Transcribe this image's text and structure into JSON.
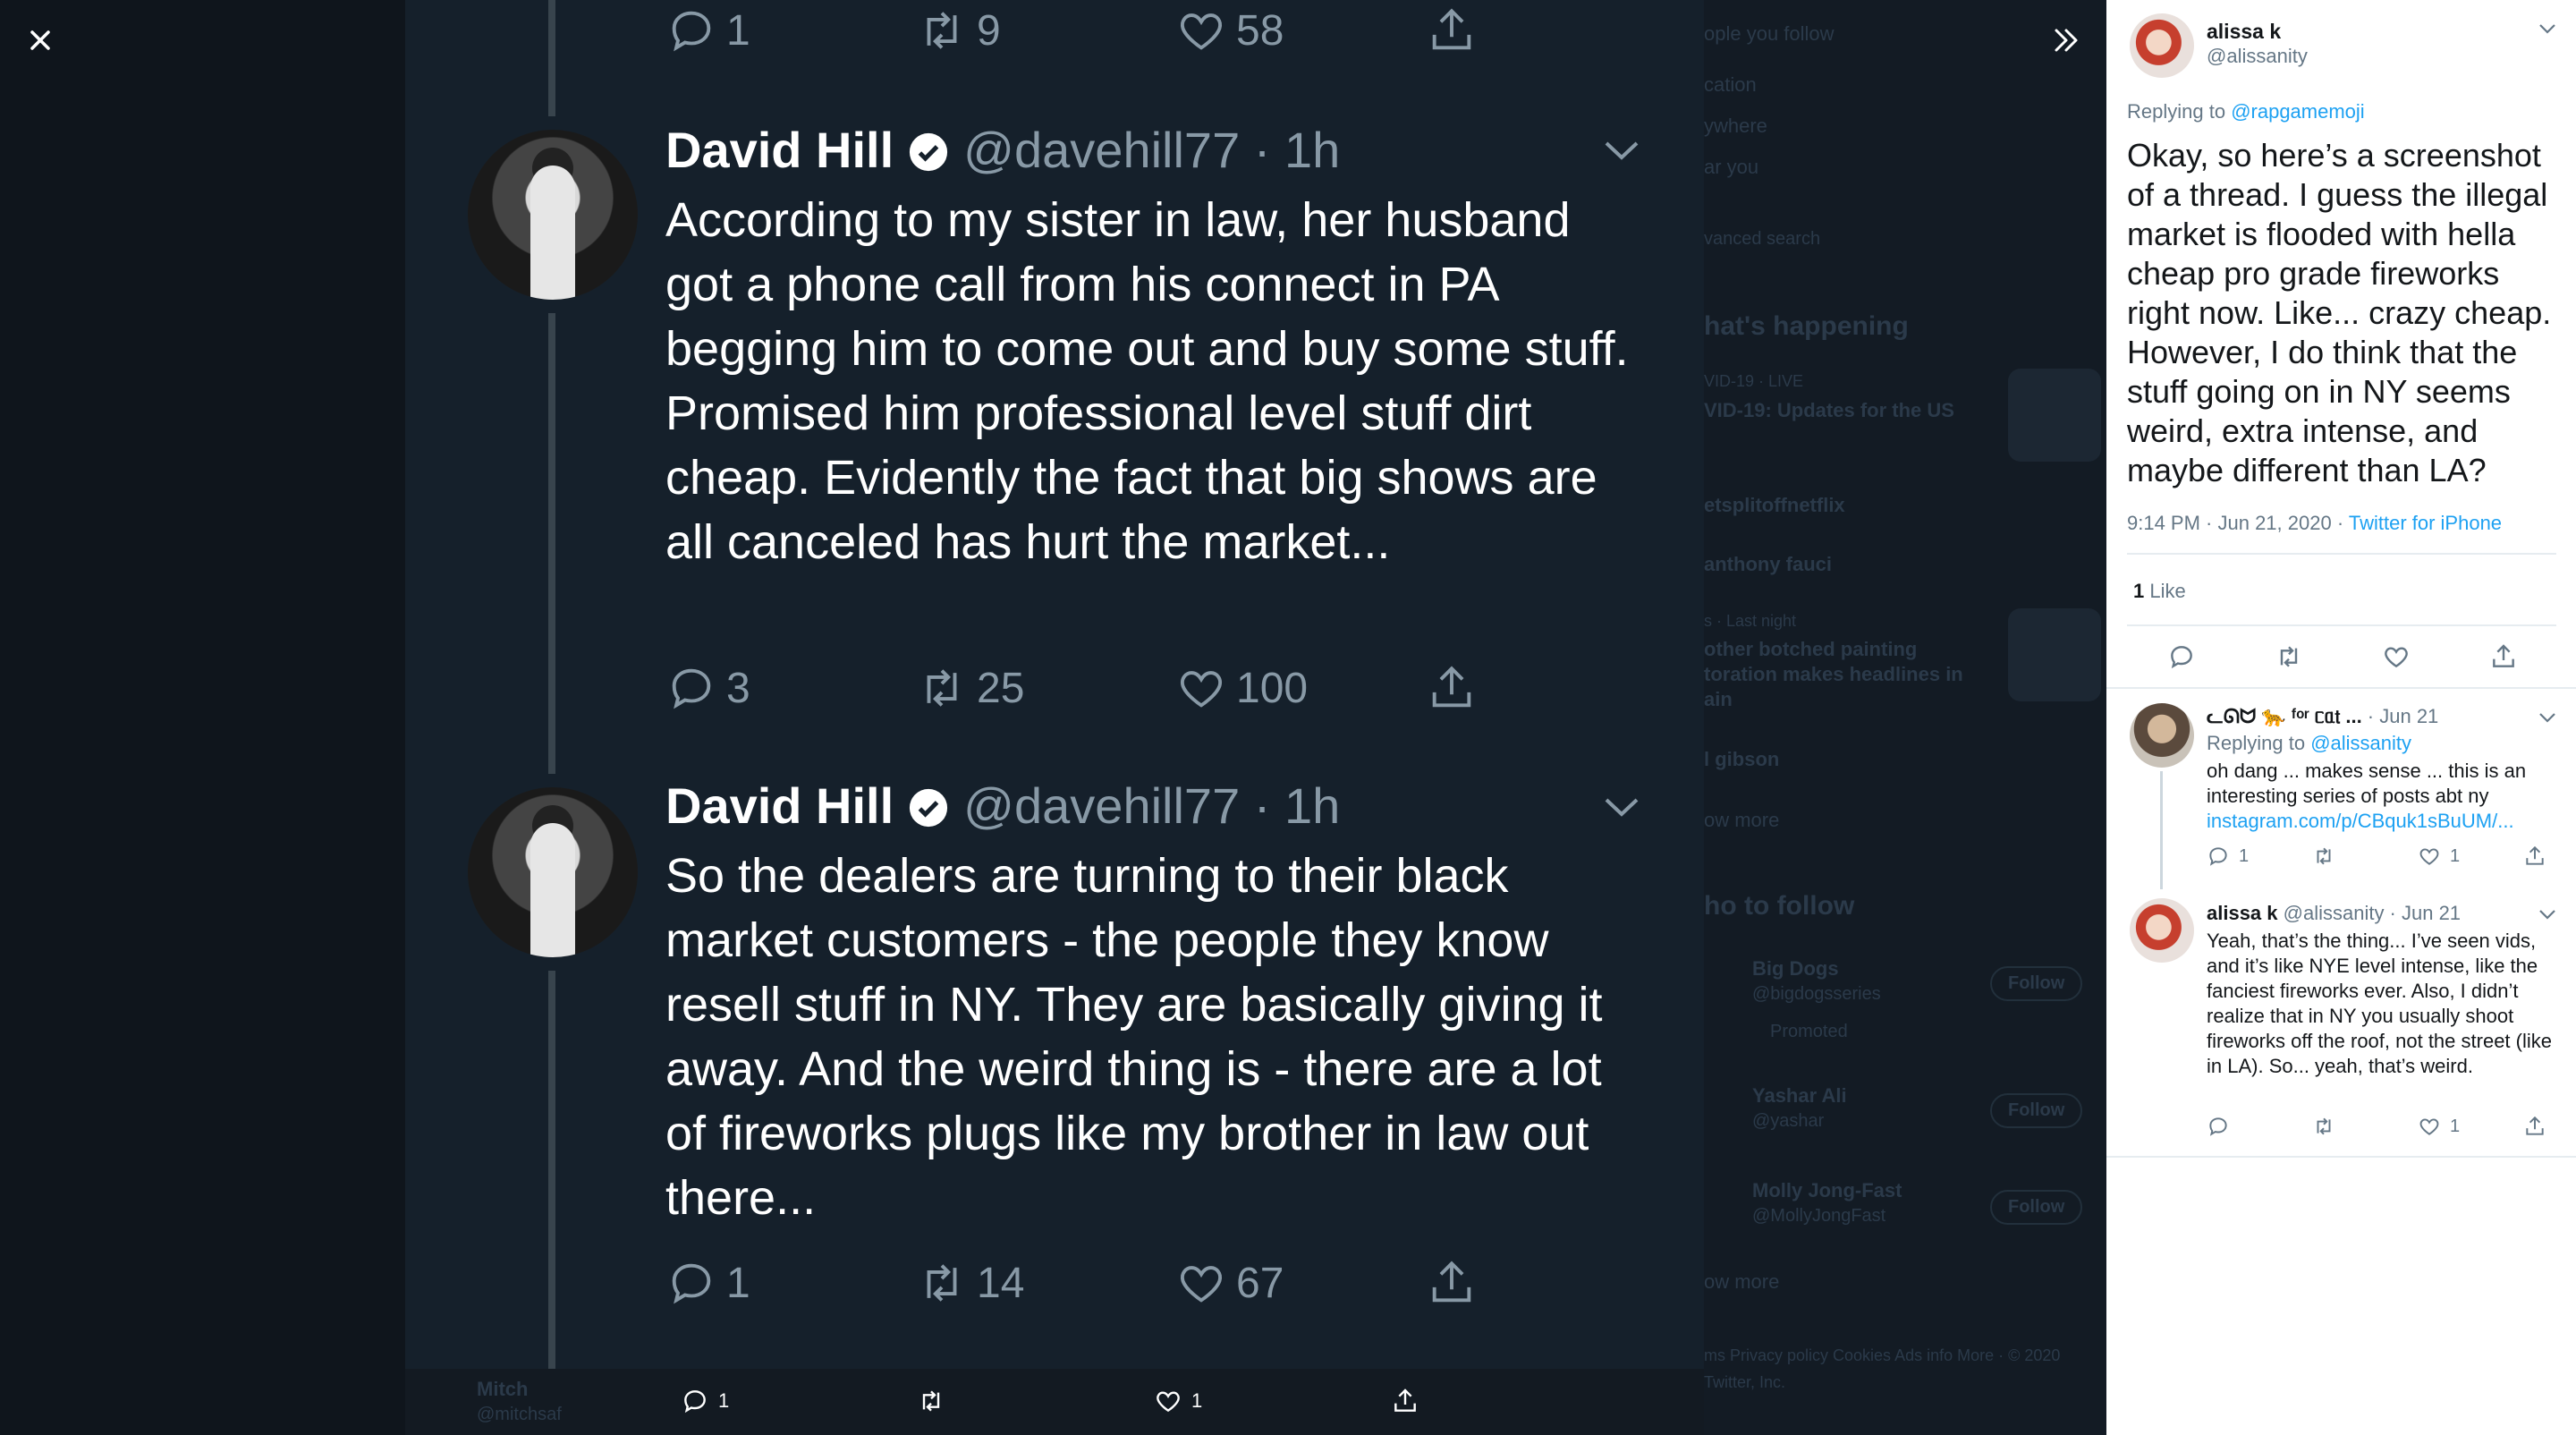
{
  "viewer": {
    "background_page": {
      "search_filters": [
        "ople you follow",
        "cation",
        "ywhere",
        "ar you",
        "vanced search"
      ],
      "whats_happening_title": "hat's happening",
      "trends": [
        {
          "meta": "VID-19 · LIVE",
          "title": "VID-19: Updates for the US"
        },
        {
          "meta": "",
          "title": "etsplitoffnetflix"
        },
        {
          "meta": "",
          "title": "anthony fauci"
        },
        {
          "meta": "s · Last night",
          "title": "other botched painting toration makes headlines in ain"
        },
        {
          "meta": "",
          "title": "l gibson"
        }
      ],
      "show_more": "ow more",
      "who_to_follow_title": "ho to follow",
      "suggestions": [
        {
          "name": "Big Dogs",
          "handle": "@bigdogsseries",
          "note": "Promoted",
          "button": "Follow"
        },
        {
          "name": "Yashar Ali",
          "handle": "@yashar",
          "button": "Follow"
        },
        {
          "name": "Molly Jong-Fast",
          "handle": "@MollyJongFast",
          "button": "Follow"
        }
      ],
      "show_more_2": "ow more",
      "footer": "ms  Privacy policy  Cookies  Ads info  More ·  © 2020 Twitter, Inc.",
      "bottom_left_name": "Mitch",
      "bottom_left_handle": "@mitchsaf"
    },
    "screenshot": {
      "top_actions": {
        "reply": "1",
        "retweet": "9",
        "like": "58"
      },
      "tweets": [
        {
          "name": "David Hill",
          "handle": "@davehill77 · 1h",
          "text": "According to my sister in law, her husband got a phone call from his connect in PA begging him to come out and buy some stuff. Promised him professional level stuff dirt cheap. Evidently the fact that big shows are all canceled has hurt the market...",
          "reply": "3",
          "retweet": "25",
          "like": "100"
        },
        {
          "name": "David Hill",
          "handle": "@davehill77 · 1h",
          "text": "So the dealers are turning to their black market customers - the people they know resell stuff in NY. They are basically giving it away. And the weird thing is - there are a lot of fireworks plugs like my brother in law out there...",
          "reply": "1",
          "retweet": "14",
          "like": "67"
        }
      ]
    },
    "bottom_actions": {
      "reply": "1",
      "like": "1"
    }
  },
  "panel": {
    "main": {
      "name": "alissa k",
      "handle": "@alissanity",
      "replying_prefix": "Replying to ",
      "replying_to": "@rapgamemoji",
      "text": "Okay, so here’s a screenshot of a thread. I guess the illegal market is flooded with hella cheap pro grade fireworks right now. Like... crazy cheap. However, I do think that the stuff going on in NY seems weird, extra intense, and maybe different than LA?",
      "timestamp": "9:14 PM · Jun 21, 2020 · ",
      "source": "Twitter for iPhone",
      "likes_count": "1",
      "likes_label": " Like"
    },
    "replies": [
      {
        "name": "ᓚᘏᗢ 🐆 ᶠᵒʳ ᥴᥲ𝗍 ...",
        "date": " · Jun 21",
        "replying_prefix": "Replying to ",
        "replying_to": "@alissanity",
        "text": "oh dang ... makes sense ... this is an interesting series of posts abt ny",
        "link": "instagram.com/p/CBquk1sBuUM/...",
        "reply": "1",
        "like": "1"
      },
      {
        "name": "alissa k",
        "handle": " @alissanity · Jun 21",
        "text": "Yeah, that’s the thing... I’ve seen vids, and it’s like NYE level intense, like the fanciest fireworks ever. Also, I didn’t realize that in NY you usually shoot fireworks off the roof, not the street (like in LA). So... yeah, that’s weird.",
        "reply": "",
        "like": "1"
      }
    ]
  }
}
